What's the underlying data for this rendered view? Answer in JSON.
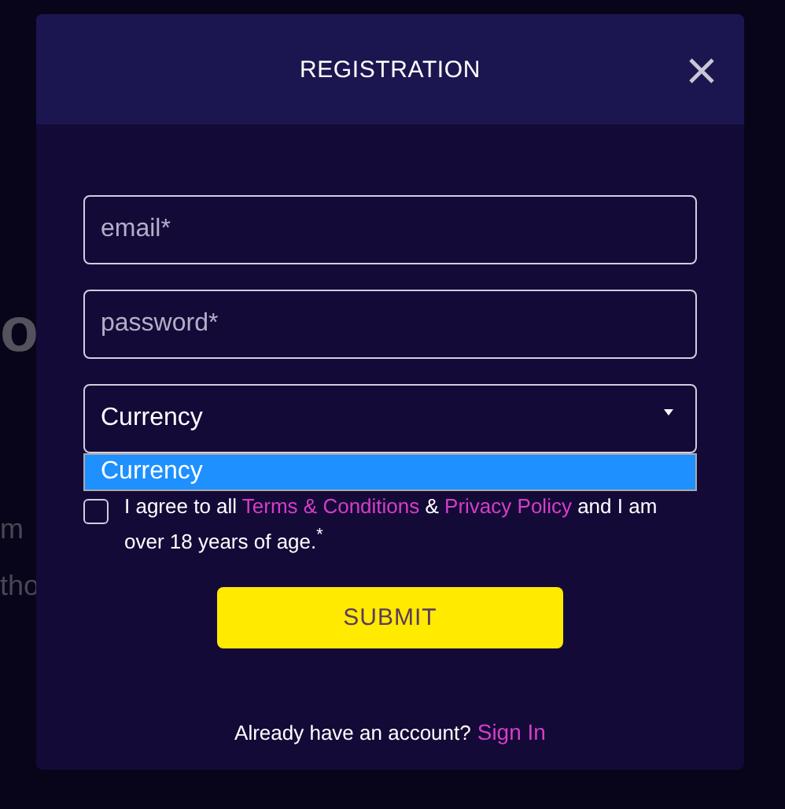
{
  "background": {
    "texts": [
      {
        "kind": "big",
        "text": "o"
      },
      {
        "kind": "small",
        "text": "m"
      },
      {
        "kind": "small",
        "text": "tho"
      }
    ]
  },
  "modal": {
    "title": "REGISTRATION",
    "fields": [
      {
        "kind": "text",
        "placeholder": "email*"
      },
      {
        "kind": "password",
        "placeholder": "password*"
      },
      {
        "kind": "select",
        "value": "Currency",
        "expanded": true,
        "options": [
          {
            "label": "Currency",
            "selected": true
          }
        ]
      }
    ],
    "agreement": {
      "checked": false,
      "parts": [
        {
          "kind": "text",
          "text": "I agree to all "
        },
        {
          "kind": "link",
          "text": "Terms & Conditions"
        },
        {
          "kind": "text",
          "text": " & "
        },
        {
          "kind": "link",
          "text": "Privacy Policy"
        },
        {
          "kind": "text",
          "text": " and I am over 18 years of age.$^{*}$"
        }
      ]
    },
    "submit": "SUBMIT",
    "footer": {
      "text": "Already have an account?",
      "link": "Sign In"
    }
  }
}
